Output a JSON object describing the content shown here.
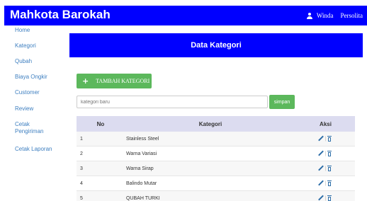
{
  "header": {
    "brand": "Mahkota Barokah",
    "user_first": "Winda",
    "user_last": "Persolita"
  },
  "sidebar": {
    "items": [
      {
        "label": "Home"
      },
      {
        "label": "Kategori"
      },
      {
        "label": "Qubah"
      },
      {
        "label": "Biaya Ongkir"
      },
      {
        "label": "Customer"
      },
      {
        "label": "Review"
      },
      {
        "label": "Cetak Pengiriman"
      },
      {
        "label": "Cetak Laporan"
      }
    ]
  },
  "panel": {
    "title": "Data Kategori"
  },
  "actions": {
    "add_label": "TAMBAH  KATEGORI",
    "input_placeholder": "kategori baru",
    "save_label": "simpan"
  },
  "table": {
    "headers": {
      "no": "No",
      "kategori": "Kategori",
      "aksi": "Aksi"
    },
    "rows": [
      {
        "no": "1",
        "kategori": "Stainless Steel"
      },
      {
        "no": "2",
        "kategori": "Warna Variasi"
      },
      {
        "no": "3",
        "kategori": "Warna Sirap"
      },
      {
        "no": "4",
        "kategori": "Balindo Mutar"
      },
      {
        "no": "5",
        "kategori": "QUBAH TURKI"
      }
    ]
  },
  "colors": {
    "primary": "#0000ff",
    "success": "#5cb85c",
    "link": "#3e7fc0",
    "table_header": "#dcdcf0"
  },
  "icons": {
    "user": "user-icon",
    "add": "plus-icon",
    "edit": "pencil-icon",
    "delete": "trash-icon"
  }
}
